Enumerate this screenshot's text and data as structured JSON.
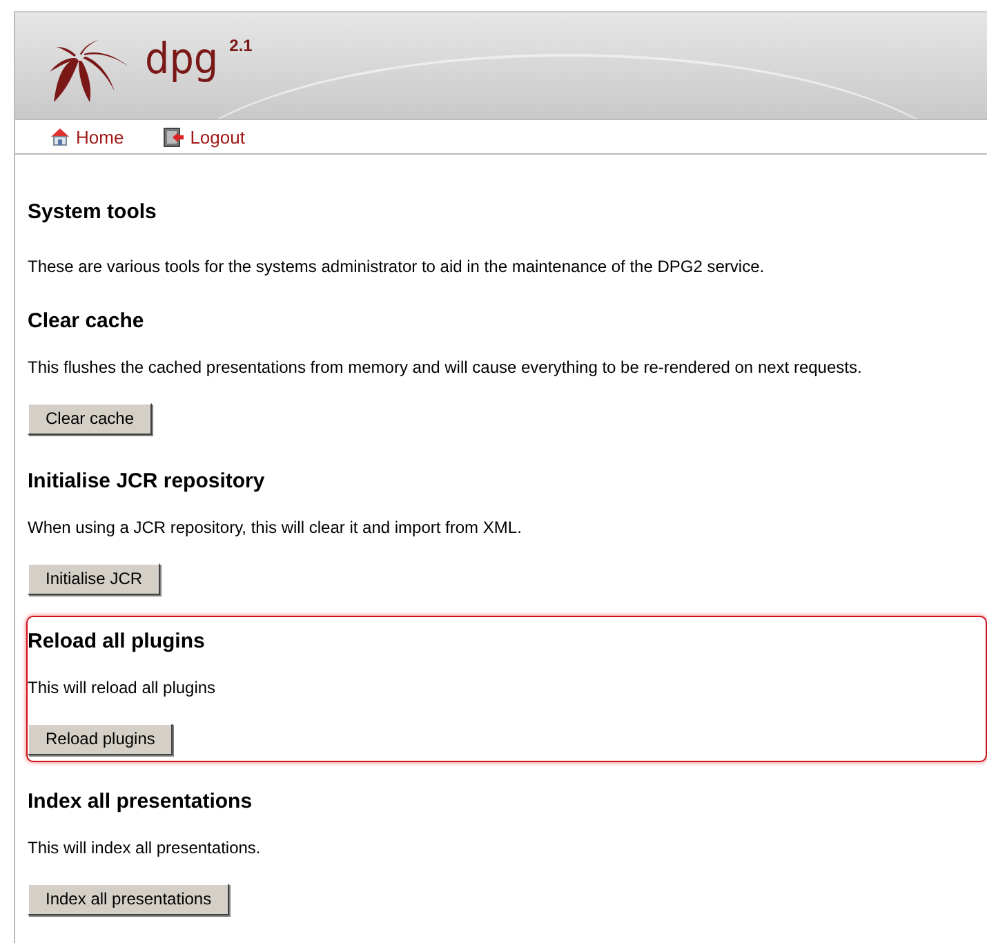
{
  "header": {
    "logo_text": "dpg",
    "version": "2.1"
  },
  "nav": [
    {
      "label": "Home",
      "kind": "home"
    },
    {
      "label": "Logout",
      "kind": "logout"
    }
  ],
  "page": {
    "title": "System tools",
    "intro": "These are various tools for the systems administrator to aid in the maintenance of the DPG2 service."
  },
  "sections": [
    {
      "heading": "Clear cache",
      "description": "This flushes the cached presentations from memory and will cause everything to be re-rendered on next requests.",
      "button": "Clear cache",
      "highlighted": false
    },
    {
      "heading": "Initialise JCR repository",
      "description": "When using a JCR repository, this will clear it and import from XML.",
      "button": "Initialise JCR",
      "highlighted": false
    },
    {
      "heading": "Reload all plugins",
      "description": "This will reload all plugins",
      "button": "Reload plugins",
      "highlighted": true
    },
    {
      "heading": "Index all presentations",
      "description": "This will index all presentations.",
      "button": "Index all presentations",
      "highlighted": false
    }
  ]
}
